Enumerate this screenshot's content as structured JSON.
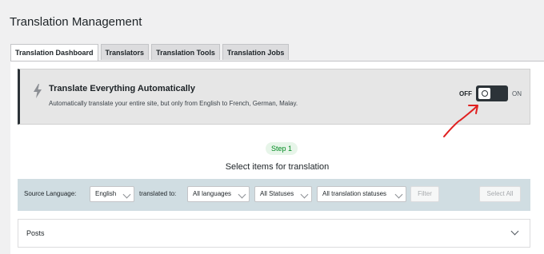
{
  "page": {
    "title": "Translation Management"
  },
  "tabs": [
    {
      "label": "Translation Dashboard",
      "active": true
    },
    {
      "label": "Translators",
      "active": false
    },
    {
      "label": "Translation Tools",
      "active": false
    },
    {
      "label": "Translation Jobs",
      "active": false
    }
  ],
  "auto_translate": {
    "title": "Translate Everything Automatically",
    "description": "Automatically translate your entire site, but only from English to French, German, Malay.",
    "off_label": "OFF",
    "on_label": "ON",
    "toggle_state": "off"
  },
  "step": {
    "badge": "Step 1",
    "title": "Select items for translation"
  },
  "filters": {
    "source_language_label": "Source Language:",
    "source_language_value": "English",
    "translated_to_label": "translated to:",
    "target_languages_value": "All languages",
    "statuses_value": "All Statuses",
    "translation_statuses_value": "All translation statuses",
    "filter_button": "Filter",
    "select_all_button": "Select All"
  },
  "sections": [
    {
      "label": "Posts"
    }
  ],
  "colors": {
    "accent_dark": "#2c3338",
    "step_green": "#008a20",
    "filter_bar_bg": "#d0dde2",
    "annotation_red": "#e02020"
  }
}
